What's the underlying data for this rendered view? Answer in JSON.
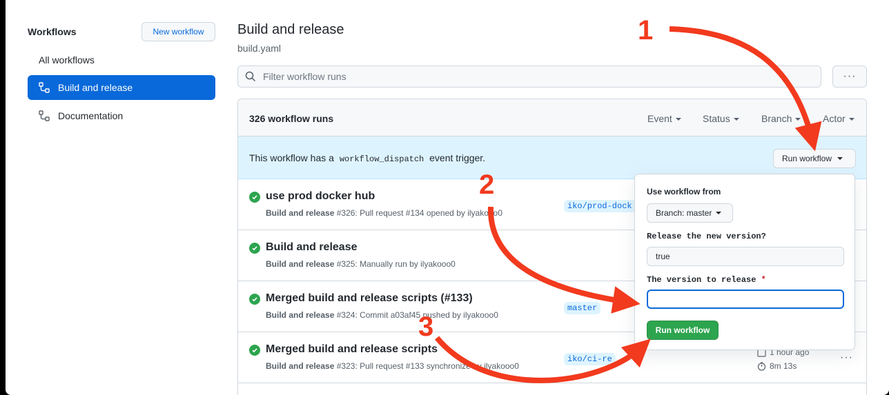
{
  "sidebar": {
    "title": "Workflows",
    "new_workflow": "New workflow",
    "all": "All workflows",
    "items": [
      {
        "label": "Build and release"
      },
      {
        "label": "Documentation"
      }
    ]
  },
  "header": {
    "title": "Build and release",
    "file": "build.yaml",
    "filter_placeholder": "Filter workflow runs",
    "more": "···"
  },
  "runs": {
    "count": "326 workflow runs",
    "filters": [
      "Event",
      "Status",
      "Branch",
      "Actor"
    ],
    "dispatch_prefix": "This workflow has a",
    "dispatch_code": "workflow_dispatch",
    "dispatch_suffix": "event trigger.",
    "run_button": "Run workflow",
    "items": [
      {
        "title": "use prod docker hub",
        "workflow": "Build and release",
        "detail": "#326: Pull request #134 opened by ilyakooo0",
        "branch": "iko/prod-dock"
      },
      {
        "title": "Build and release",
        "workflow": "Build and release",
        "detail": "#325: Manually run by ilyakooo0",
        "branch": ""
      },
      {
        "title": "Merged build and release scripts (#133)",
        "workflow": "Build and release",
        "detail": "#324: Commit a03af45 pushed by ilyakooo0",
        "branch": "master"
      },
      {
        "title": "Merged build and release scripts",
        "workflow": "Build and release",
        "detail": "#323: Pull request #133 synchronize by ilyakooo0",
        "branch": "iko/ci-re",
        "time": "1 hour ago",
        "duration": "8m 13s"
      }
    ],
    "row_menu": "···"
  },
  "popover": {
    "use_from": "Use workflow from",
    "branch": "Branch: master",
    "q1": "Release the new version?",
    "q1_value": "true",
    "q2": "The version to release",
    "q2_required": "*",
    "q2_value": "",
    "submit": "Run workflow"
  },
  "annotations": {
    "a1": "1",
    "a2": "2",
    "a3": "3"
  },
  "colors": {
    "accent": "#0969da",
    "success": "#2da44e",
    "annotation": "#f23a1e"
  }
}
